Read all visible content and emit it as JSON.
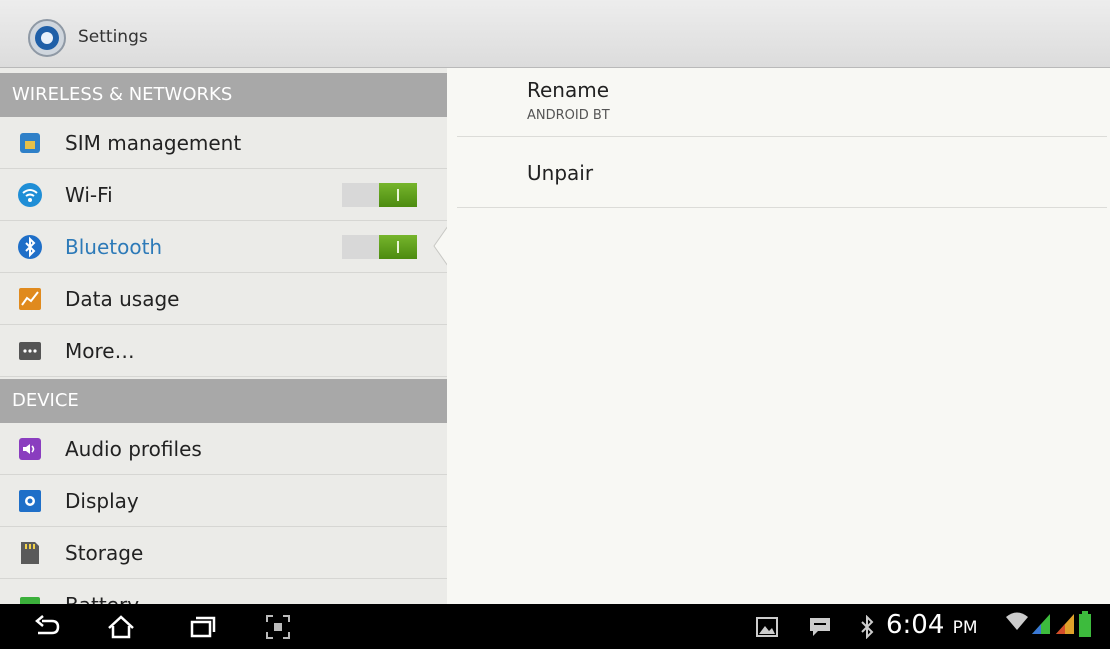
{
  "titlebar": {
    "title": "Settings",
    "icon": "settings-gear-icon"
  },
  "sidebar": {
    "sections": [
      {
        "header": "WIRELESS & NETWORKS"
      },
      {
        "header": "DEVICE"
      }
    ],
    "items": [
      {
        "label": "SIM management",
        "icon": "sim-card-icon"
      },
      {
        "label": "Wi-Fi",
        "icon": "wifi-icon",
        "toggle": "on"
      },
      {
        "label": "Bluetooth",
        "icon": "bluetooth-icon",
        "toggle": "on",
        "selected": true
      },
      {
        "label": "Data usage",
        "icon": "data-usage-icon"
      },
      {
        "label": "More…",
        "icon": "more-icon"
      },
      {
        "label": "Audio profiles",
        "icon": "audio-profiles-icon"
      },
      {
        "label": "Display",
        "icon": "display-icon"
      },
      {
        "label": "Storage",
        "icon": "storage-icon"
      },
      {
        "label": "Battery",
        "icon": "battery-icon"
      }
    ]
  },
  "detail": {
    "rename": {
      "title": "Rename",
      "subtitle": "ANDROID BT"
    },
    "unpair": {
      "title": "Unpair"
    }
  },
  "statusbar": {
    "time": "6:04",
    "ampm": "PM",
    "icons": [
      "back-icon",
      "home-icon",
      "recent-apps-icon",
      "screenshot-icon",
      "gallery-notification-icon",
      "message-notification-icon",
      "bluetooth-status-icon",
      "wifi-signal-icon",
      "cell-signal-icon",
      "battery-status-icon"
    ]
  },
  "colors": {
    "accent": "#2d7ab8",
    "toggle_on": "#5f9e1e",
    "section_header": "#a8a8a8"
  }
}
